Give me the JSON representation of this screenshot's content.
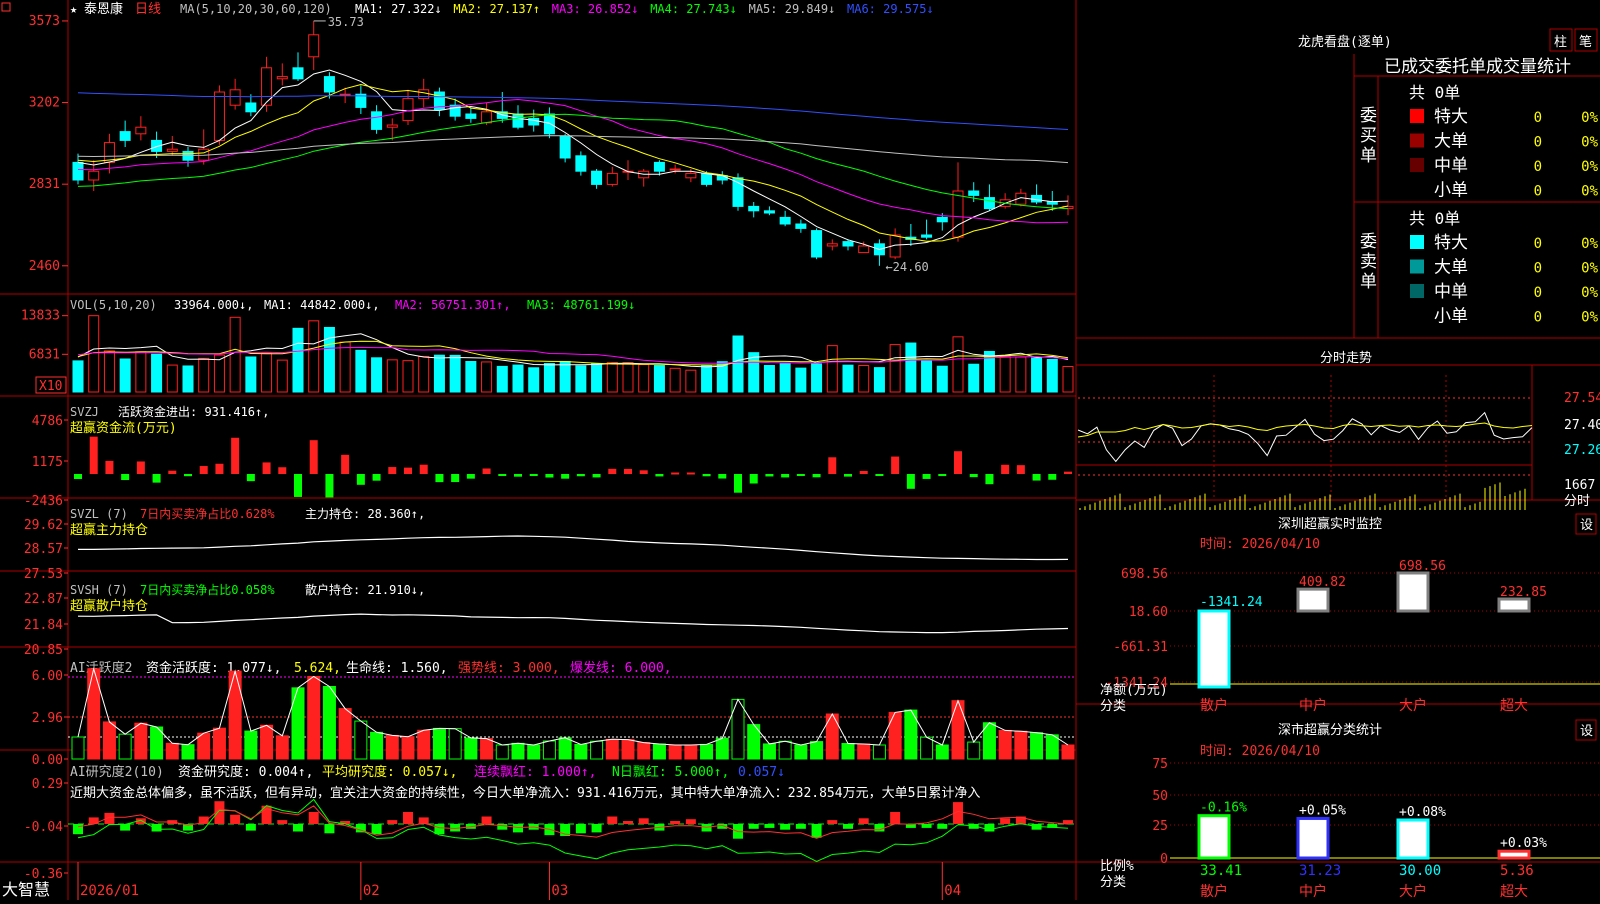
{
  "colors": {
    "up": "#ff2020",
    "down": "#00ffff",
    "vol_up_fill": "#000",
    "ma1": "#ffffff",
    "ma2": "#ffff00",
    "ma3": "#ff00ff",
    "ma4": "#00ff00",
    "ma5": "#c0c0c0",
    "ma6": "#3050ff",
    "frame": "#b00000",
    "green_bar": "#00ff00",
    "text_yellow": "#ffff00",
    "text_red": "#ff3030"
  },
  "stock": {
    "star": "★",
    "name": "泰恩康",
    "period": "日线",
    "ma_label": "MA(5,10,20,30,60,120)",
    "ma": [
      {
        "label": "MA1: 27.322↓",
        "color": "#ffffff"
      },
      {
        "label": "MA2: 27.137↑",
        "color": "#ffff00"
      },
      {
        "label": "MA3: 26.852↓",
        "color": "#ff00ff"
      },
      {
        "label": "MA4: 27.743↓",
        "color": "#00ff00"
      },
      {
        "label": "MA5: 29.849↓",
        "color": "#c0c0c0"
      },
      {
        "label": "MA6: 29.575↓",
        "color": "#3050ff"
      }
    ],
    "high_label": "35.73",
    "low_label": "←24.60"
  },
  "chart_data": {
    "type": "candlestick",
    "dates_axis": [
      "2026/01",
      "02",
      "03",
      "04"
    ],
    "price_ticks": [
      "3573",
      "3202",
      "2831",
      "2460"
    ],
    "candles": [
      [
        29.3,
        28.5,
        29.7,
        28.3
      ],
      [
        28.5,
        28.9,
        29.4,
        28.0
      ],
      [
        29.3,
        30.2,
        30.6,
        28.8
      ],
      [
        30.7,
        30.3,
        31.2,
        30.0
      ],
      [
        30.6,
        30.9,
        31.4,
        30.3
      ],
      [
        30.3,
        29.8,
        30.7,
        29.5
      ],
      [
        29.8,
        29.9,
        30.5,
        29.6
      ],
      [
        29.8,
        29.4,
        30.0,
        29.1
      ],
      [
        29.4,
        29.9,
        30.8,
        29.2
      ],
      [
        30.3,
        32.5,
        32.8,
        30.1
      ],
      [
        31.9,
        32.6,
        33.1,
        31.7
      ],
      [
        32.0,
        31.6,
        32.4,
        31.4
      ],
      [
        31.9,
        33.6,
        34.1,
        31.6
      ],
      [
        33.1,
        33.2,
        33.8,
        32.8
      ],
      [
        33.6,
        33.1,
        34.3,
        33.0
      ],
      [
        34.1,
        35.1,
        35.73,
        33.5
      ],
      [
        33.2,
        32.5,
        33.4,
        32.2
      ],
      [
        32.4,
        32.4,
        32.7,
        32.0
      ],
      [
        32.4,
        31.8,
        32.8,
        31.5
      ],
      [
        31.6,
        30.8,
        31.9,
        30.6
      ],
      [
        30.9,
        31.0,
        31.3,
        30.3
      ],
      [
        31.2,
        32.2,
        32.6,
        31.0
      ],
      [
        32.2,
        32.6,
        33.1,
        31.8
      ],
      [
        32.5,
        31.7,
        32.7,
        31.4
      ],
      [
        31.9,
        31.4,
        32.2,
        31.2
      ],
      [
        31.5,
        31.3,
        31.8,
        31.1
      ],
      [
        31.1,
        31.6,
        32.0,
        31.0
      ],
      [
        31.6,
        31.3,
        32.5,
        31.1
      ],
      [
        31.5,
        30.9,
        31.9,
        30.8
      ],
      [
        31.3,
        31.0,
        31.7,
        30.7
      ],
      [
        31.5,
        30.6,
        31.8,
        30.4
      ],
      [
        30.5,
        29.5,
        30.6,
        29.3
      ],
      [
        29.6,
        28.9,
        29.8,
        28.7
      ],
      [
        28.9,
        28.3,
        29.0,
        28.1
      ],
      [
        28.3,
        28.8,
        29.1,
        28.2
      ],
      [
        28.9,
        28.9,
        29.4,
        28.5
      ],
      [
        28.6,
        28.9,
        29.0,
        28.2
      ],
      [
        29.3,
        28.9,
        29.4,
        28.7
      ],
      [
        29.0,
        29.0,
        29.2,
        28.8
      ],
      [
        28.6,
        28.8,
        29.0,
        28.4
      ],
      [
        28.8,
        28.3,
        28.9,
        28.2
      ],
      [
        28.7,
        28.5,
        28.9,
        28.3
      ],
      [
        28.6,
        27.3,
        28.8,
        27.1
      ],
      [
        27.3,
        27.1,
        27.5,
        26.8
      ],
      [
        27.1,
        27.0,
        27.3,
        26.9
      ],
      [
        26.8,
        26.5,
        27.1,
        26.4
      ],
      [
        26.5,
        26.3,
        26.7,
        26.1
      ],
      [
        26.2,
        25.0,
        26.3,
        24.9
      ],
      [
        25.5,
        25.6,
        25.8,
        25.3
      ],
      [
        25.7,
        25.5,
        25.8,
        25.3
      ],
      [
        25.2,
        25.5,
        25.7,
        25.2
      ],
      [
        25.6,
        25.1,
        25.8,
        24.6
      ],
      [
        25.0,
        26.0,
        26.3,
        24.9
      ],
      [
        25.9,
        25.8,
        26.5,
        25.5
      ],
      [
        26.0,
        25.9,
        26.7,
        25.8
      ],
      [
        26.8,
        26.6,
        27.0,
        26.2
      ],
      [
        25.9,
        28.0,
        29.3,
        25.7
      ],
      [
        28.0,
        27.8,
        28.4,
        27.5
      ],
      [
        27.7,
        27.2,
        28.3,
        27.1
      ],
      [
        27.3,
        27.6,
        27.9,
        27.2
      ],
      [
        27.4,
        27.9,
        28.1,
        27.3
      ],
      [
        27.8,
        27.5,
        28.3,
        27.4
      ],
      [
        27.5,
        27.4,
        28.0,
        27.1
      ],
      [
        27.2,
        27.3,
        27.8,
        26.9
      ]
    ],
    "volume_ticks": [
      "13833",
      "6831",
      "X10"
    ],
    "volume": [
      5640,
      13830,
      7450,
      5980,
      7300,
      6840,
      4880,
      4720,
      6100,
      6700,
      13540,
      6350,
      7050,
      5780,
      11540,
      12900,
      11700,
      9050,
      7550,
      6200,
      5830,
      5680,
      6450,
      6670,
      6640,
      5530,
      5450,
      4640,
      4880,
      4390,
      5160,
      5540,
      4740,
      5130,
      5360,
      5330,
      4970,
      4800,
      4290,
      3950,
      4750,
      5490,
      10150,
      7130,
      4810,
      5130,
      4330,
      5090,
      8400,
      4860,
      4800,
      4420,
      8590,
      8870,
      5620,
      4670,
      10000,
      5030,
      7350,
      6430,
      6330,
      6160,
      5900,
      4620
    ],
    "indicators": {
      "svzj": {
        "label": "SVZJ",
        "title": "活跃资金进出: 931.416↑,",
        "sub": "超赢资金流(万元)",
        "ticks": [
          "4786",
          "1175",
          "-2436"
        ]
      },
      "svzl": {
        "label": "SVZL (7)",
        "pct": "7日内买卖净占比0.628%",
        "hold": "主力持仓: 28.360↑,",
        "sub": "超赢主力持仓",
        "ticks": [
          "29.62",
          "28.57",
          "27.53"
        ]
      },
      "svsh": {
        "label": "SVSH (7)",
        "pct": "7日内买卖净占比0.058%",
        "hold": "散户持仓: 21.910↓,",
        "sub": "超赢散户持仓",
        "ticks": [
          "22.87",
          "21.84",
          "20.85"
        ]
      },
      "ai2": {
        "label": "AI活跃度2",
        "a": "资金活跃度: 1.077↓,",
        "b": "5.624,",
        "c": "生命线: 1.560,",
        "d": "强势线: 3.000,",
        "e": "爆发线: 6.000,",
        "ticks": [
          "6.00",
          "2.96",
          "0.00"
        ]
      },
      "ai3": {
        "label": "AI研究度2(10)",
        "a": "资金研究度: 0.004↑,",
        "b": "平均研究度: 0.057↓,",
        "c": "连续飘红: 1.000↑,",
        "d": "N日飘红: 5.000↑,",
        "e": "0.057↓",
        "note": "近期大资金总体偏多，虽不活跃，但有异动，宜关注大资金的持续性，今日大单净流入：931.416万元，其中特大单净流入：232.854万元，大单5日累计净入",
        "ticks": [
          "0.29",
          "-0.04",
          "-0.36"
        ]
      }
    }
  },
  "brand": "大智慧",
  "right": {
    "title": "龙虎看盘(逐单)",
    "tab1": "柱",
    "tab2": "笔",
    "stats_header": "已成交委托单成交量统计",
    "buy_side": "委买单",
    "sell_side": "委卖单",
    "buy_total": "共 0单",
    "sell_total": "共 0单",
    "buy_rows": [
      {
        "label": "特大",
        "n": "0",
        "pct": "0%"
      },
      {
        "label": "大单",
        "n": "0",
        "pct": "0%"
      },
      {
        "label": "中单",
        "n": "0",
        "pct": "0%"
      },
      {
        "label": "小单",
        "n": "0",
        "pct": "0%"
      }
    ],
    "sell_rows": [
      {
        "label": "特大",
        "n": "0",
        "pct": "0%"
      },
      {
        "label": "大单",
        "n": "0",
        "pct": "0%"
      },
      {
        "label": "中单",
        "n": "0",
        "pct": "0%"
      },
      {
        "label": "小单",
        "n": "0",
        "pct": "0%"
      }
    ],
    "fenshi_title": "分时走势",
    "fenshi_ticks": [
      "27.54",
      "27.40",
      "27.26"
    ],
    "fenshi_vol": "1667",
    "fenshi_vol_unit": "分时",
    "sz_title": "深圳超赢实时监控",
    "sz_set": "设",
    "sz_time": "时间: 2026/04/10",
    "sz_ticks": [
      "698.56",
      "18.60",
      "-661.31",
      "-1341.24"
    ],
    "sz_ylabel1": "净额(万元)",
    "sz_ylabel2": "分类",
    "sz_values": [
      {
        "label": "散户",
        "value": "-1341.24"
      },
      {
        "label": "中户",
        "value": "409.82"
      },
      {
        "label": "大户",
        "value": "698.56"
      },
      {
        "label": "超大",
        "value": "232.85"
      }
    ],
    "sc_title": "深市超赢分类统计",
    "sc_set": "设",
    "sc_time": "时间: 2026/04/10",
    "sc_ticks": [
      "75",
      "50",
      "25",
      "0"
    ],
    "sc_ylabel1": "比例%",
    "sc_ylabel2": "分类",
    "sc_values": [
      {
        "label": "散户",
        "value": "33.41",
        "delta": "-0.16%"
      },
      {
        "label": "中户",
        "value": "31.23",
        "delta": "+0.05%"
      },
      {
        "label": "大户",
        "value": "30.00",
        "delta": "+0.08%"
      },
      {
        "label": "超大",
        "value": "5.36",
        "delta": "+0.03%"
      }
    ]
  }
}
